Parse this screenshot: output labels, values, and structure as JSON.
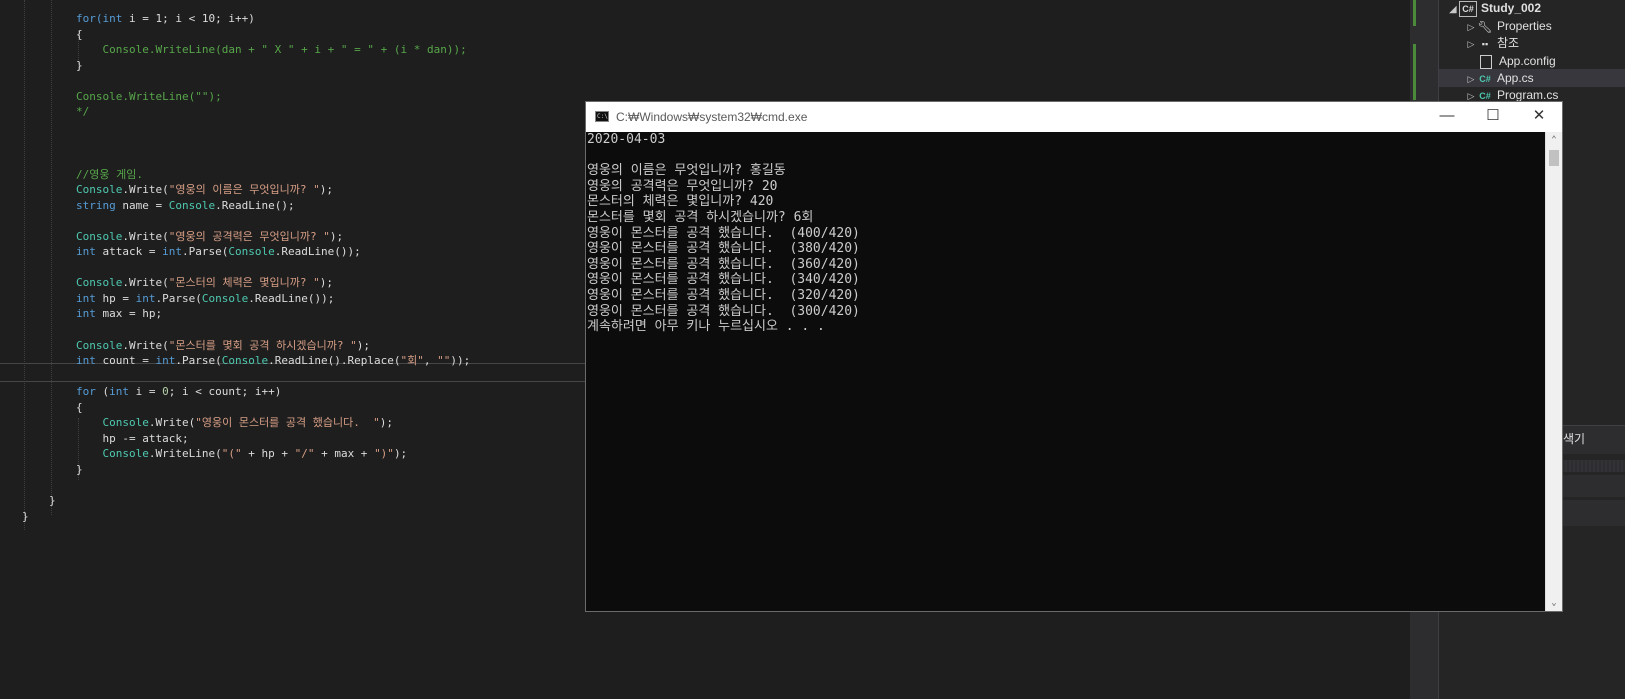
{
  "editor": {
    "lines": [
      [
        [
          "for(",
          "kw"
        ],
        [
          "int",
          "kw"
        ],
        [
          " i = 1; i < 10; i++)",
          ""
        ]
      ],
      [
        [
          "{",
          ""
        ]
      ],
      [
        [
          "    Console.WriteLine(dan + \" X \" + i + \" = \" + (i * dan));",
          "cm"
        ]
      ],
      [
        [
          "}",
          ""
        ]
      ],
      [
        [
          "",
          ""
        ]
      ],
      [
        [
          "Console.WriteLine(\"\");",
          "cm"
        ]
      ],
      [
        [
          "*/",
          "cm"
        ]
      ],
      [
        [
          "",
          ""
        ]
      ],
      [
        [
          "",
          ""
        ]
      ],
      [
        [
          "",
          ""
        ]
      ],
      [
        [
          "//영웅 게임.",
          "cm"
        ]
      ],
      [
        [
          "Console",
          "ty"
        ],
        [
          ".Write(",
          ""
        ],
        [
          "\"영웅의 이름은 무엇입니까? \"",
          "st"
        ],
        [
          ");",
          ""
        ]
      ],
      [
        [
          "string",
          "kw"
        ],
        [
          " name = ",
          ""
        ],
        [
          "Console",
          "ty"
        ],
        [
          ".ReadLine();",
          ""
        ]
      ],
      [
        [
          "",
          ""
        ]
      ],
      [
        [
          "Console",
          "ty"
        ],
        [
          ".Write(",
          ""
        ],
        [
          "\"영웅의 공격력은 무엇입니까? \"",
          "st"
        ],
        [
          ");",
          ""
        ]
      ],
      [
        [
          "int",
          "kw"
        ],
        [
          " attack = ",
          ""
        ],
        [
          "int",
          "kw"
        ],
        [
          ".Parse(",
          ""
        ],
        [
          "Console",
          "ty"
        ],
        [
          ".ReadLine());",
          ""
        ]
      ],
      [
        [
          "",
          ""
        ]
      ],
      [
        [
          "Console",
          "ty"
        ],
        [
          ".Write(",
          ""
        ],
        [
          "\"몬스터의 체력은 몇입니까? \"",
          "st"
        ],
        [
          ");",
          ""
        ]
      ],
      [
        [
          "int",
          "kw"
        ],
        [
          " hp = ",
          ""
        ],
        [
          "int",
          "kw"
        ],
        [
          ".Parse(",
          ""
        ],
        [
          "Console",
          "ty"
        ],
        [
          ".ReadLine());",
          ""
        ]
      ],
      [
        [
          "int",
          "kw"
        ],
        [
          " max = hp;",
          ""
        ]
      ],
      [
        [
          "",
          ""
        ]
      ],
      [
        [
          "Console",
          "ty"
        ],
        [
          ".Write(",
          ""
        ],
        [
          "\"몬스터를 몇회 공격 하시겠습니까? \"",
          "st"
        ],
        [
          ");",
          ""
        ]
      ],
      [
        [
          "int",
          "kw"
        ],
        [
          " count = ",
          ""
        ],
        [
          "int",
          "kw"
        ],
        [
          ".Parse(",
          ""
        ],
        [
          "Console",
          "ty"
        ],
        [
          ".ReadLine().Replace(",
          ""
        ],
        [
          "\"회\"",
          "st"
        ],
        [
          ", ",
          ""
        ],
        [
          "\"\"",
          "st"
        ],
        [
          "));",
          ""
        ]
      ],
      [
        [
          "",
          ""
        ]
      ],
      [
        [
          "for",
          "kw"
        ],
        [
          " (",
          ""
        ],
        [
          "int",
          "kw"
        ],
        [
          " i = ",
          ""
        ],
        [
          "0",
          "nm"
        ],
        [
          "; i < count; i++)",
          ""
        ]
      ],
      [
        [
          "{",
          ""
        ]
      ],
      [
        [
          "    ",
          ""
        ],
        [
          "Console",
          "ty"
        ],
        [
          ".Write(",
          ""
        ],
        [
          "\"영웅이 몬스터를 공격 했습니다.  \"",
          "st"
        ],
        [
          ");",
          ""
        ]
      ],
      [
        [
          "    hp -= attack;",
          ""
        ]
      ],
      [
        [
          "    ",
          ""
        ],
        [
          "Console",
          "ty"
        ],
        [
          ".WriteLine(",
          ""
        ],
        [
          "\"(\"",
          "st"
        ],
        [
          " + hp + ",
          ""
        ],
        [
          "\"/\"",
          "st"
        ],
        [
          " + max + ",
          ""
        ],
        [
          "\")\"",
          "st"
        ],
        [
          ");",
          ""
        ]
      ],
      [
        [
          "}",
          ""
        ]
      ],
      [
        [
          "",
          ""
        ]
      ],
      [
        [
          "}",
          ""
        ]
      ],
      [
        [
          "}",
          ""
        ]
      ]
    ]
  },
  "explorer": {
    "project": "Study_002",
    "items": [
      "Properties",
      "참조",
      "App.config",
      "App.cs",
      "Program.cs"
    ],
    "selected": "App.cs",
    "partial_label": "색기"
  },
  "cmd": {
    "title": "C:₩Windows₩system32₩cmd.exe",
    "minimize": "—",
    "maximize": "☐",
    "close": "✕",
    "output": [
      "2020-04-03",
      "",
      "영웅의 이름은 무엇입니까? 홍길동",
      "영웅의 공격력은 무엇입니까? 20",
      "몬스터의 체력은 몇입니까? 420",
      "몬스터를 몇회 공격 하시겠습니까? 6회",
      "영웅이 몬스터를 공격 했습니다.  (400/420)",
      "영웅이 몬스터를 공격 했습니다.  (380/420)",
      "영웅이 몬스터를 공격 했습니다.  (360/420)",
      "영웅이 몬스터를 공격 했습니다.  (340/420)",
      "영웅이 몬스터를 공격 했습니다.  (320/420)",
      "영웅이 몬스터를 공격 했습니다.  (300/420)",
      "계속하려면 아무 키나 누르십시오 . . ."
    ]
  },
  "colors": {
    "editor_bg": "#1e1e1e",
    "keyword": "#569cd6",
    "type": "#4ec9b0",
    "string": "#d69d85",
    "comment": "#57a64a",
    "console_bg": "#0c0c0c",
    "console_text": "#cccccc"
  }
}
